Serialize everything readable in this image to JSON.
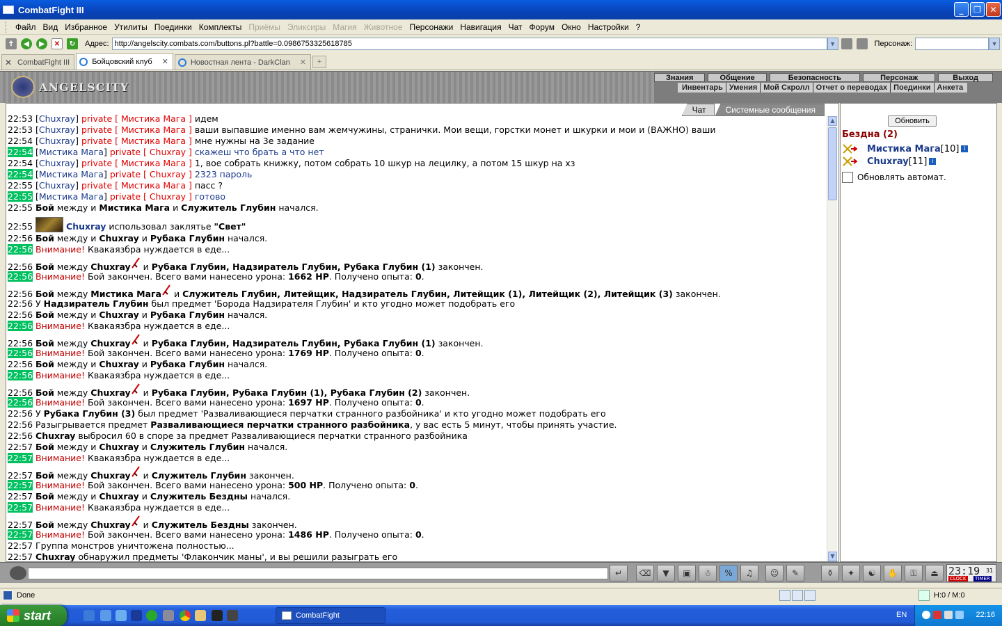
{
  "window": {
    "title": "CombatFight III"
  },
  "menu": [
    "Файл",
    "Вид",
    "Избранное",
    "Утилиты",
    "Поединки",
    "Комплекты",
    "Приёмы",
    "Эликсиры",
    "Магия",
    "Животное",
    "Персонажи",
    "Навигация",
    "Чат",
    "Форум",
    "Окно",
    "Настройки",
    "?"
  ],
  "menu_disabled": [
    "Приёмы",
    "Эликсиры",
    "Магия",
    "Животное"
  ],
  "address": {
    "label": "Адрес:",
    "url": "http://angelscity.combats.com/buttons.pl?battle=0.0986753325618785",
    "char_label": "Персонаж:"
  },
  "tabs": [
    {
      "label": "CombatFight III"
    },
    {
      "label": "Бойцовский клуб"
    },
    {
      "label": "Новостная лента - DarkClan"
    }
  ],
  "game": {
    "brand": "ANGELSCITY",
    "nav_top": [
      "Знания",
      "Общение",
      "Безопасность",
      "Персонаж",
      "Выход"
    ],
    "nav_bottom": [
      "Инвентарь",
      "Умения",
      "Мой Скролл",
      "Отчет о переводах",
      "Поединки",
      "Анкета"
    ]
  },
  "chat_tabs": {
    "chat": "Чат",
    "system": "Системные сообщения"
  },
  "chat": [
    {
      "t": "22:53",
      "hl": false,
      "parts": [
        [
          "n",
          "["
        ],
        [
          "nick",
          "Chuxray"
        ],
        [
          "n",
          "] "
        ],
        [
          "priv",
          "private [ Мистика Мага ]"
        ],
        [
          "n",
          " идем"
        ]
      ]
    },
    {
      "t": "22:53",
      "hl": false,
      "parts": [
        [
          "n",
          "["
        ],
        [
          "nick",
          "Chuxray"
        ],
        [
          "n",
          "] "
        ],
        [
          "priv",
          "private [ Мистика Мага ]"
        ],
        [
          "n",
          " ваши выпавшие именно вам жемчужины, странички. Мои вещи, горстки монет и шкурки и мои и (ВАЖНО) ваши"
        ]
      ]
    },
    {
      "t": "22:54",
      "hl": false,
      "parts": [
        [
          "n",
          "["
        ],
        [
          "nick",
          "Chuxray"
        ],
        [
          "n",
          "] "
        ],
        [
          "priv",
          "private [ Мистика Мага ]"
        ],
        [
          "n",
          " мне нужны на 3е задание"
        ]
      ]
    },
    {
      "t": "22:54",
      "hl": true,
      "parts": [
        [
          "n",
          "["
        ],
        [
          "nick",
          "Мистика Мага"
        ],
        [
          "n",
          "] "
        ],
        [
          "priv",
          "private [ Chuxray ]"
        ],
        [
          "me",
          " скажеш что брать а что нет"
        ]
      ]
    },
    {
      "t": "22:54",
      "hl": false,
      "parts": [
        [
          "n",
          "["
        ],
        [
          "nick",
          "Chuxray"
        ],
        [
          "n",
          "] "
        ],
        [
          "priv",
          "private [ Мистика Мага ]"
        ],
        [
          "n",
          " 1, вое собрать книжку, потом собрать 10 шкур на лецилку, а потом 15 шкур на хз"
        ]
      ]
    },
    {
      "t": "22:54",
      "hl": true,
      "parts": [
        [
          "n",
          "["
        ],
        [
          "nick",
          "Мистика Мага"
        ],
        [
          "n",
          "] "
        ],
        [
          "priv",
          "private [ Chuxray ]"
        ],
        [
          "me",
          " 2323 пароль"
        ]
      ]
    },
    {
      "t": "22:55",
      "hl": false,
      "parts": [
        [
          "n",
          "["
        ],
        [
          "nick",
          "Chuxray"
        ],
        [
          "n",
          "] "
        ],
        [
          "priv",
          "private [ Мистика Мага ]"
        ],
        [
          "n",
          " пасс ?"
        ]
      ]
    },
    {
      "t": "22:55",
      "hl": true,
      "parts": [
        [
          "n",
          "["
        ],
        [
          "nick",
          "Мистика Мага"
        ],
        [
          "n",
          "] "
        ],
        [
          "priv",
          "private [ Chuxray ]"
        ],
        [
          "me",
          " готово"
        ]
      ]
    },
    {
      "t": "22:55",
      "hl": false,
      "parts": [
        [
          "b",
          "Бой"
        ],
        [
          "n",
          " между и "
        ],
        [
          "b",
          "Мистика Мага"
        ],
        [
          "n",
          " и "
        ],
        [
          "b",
          "Служитель Глубин"
        ],
        [
          "n",
          " начался."
        ]
      ]
    },
    {
      "t": "22:55",
      "hl": false,
      "kind": "spell",
      "parts": [
        [
          "spell",
          ""
        ],
        [
          "nickb",
          "Chuxray"
        ],
        [
          "n",
          " использовал заклятье "
        ],
        [
          "b",
          "\"Свет\""
        ]
      ]
    },
    {
      "t": "22:56",
      "hl": false,
      "parts": [
        [
          "b",
          "Бой"
        ],
        [
          "n",
          " между и "
        ],
        [
          "b",
          "Chuxray"
        ],
        [
          "n",
          " и "
        ],
        [
          "b",
          "Рубака Глубин"
        ],
        [
          "n",
          " начался."
        ]
      ]
    },
    {
      "t": "22:56",
      "hl": true,
      "parts": [
        [
          "warn",
          "Внимание!"
        ],
        [
          "n",
          " Квакаязбра нуждается в еде..."
        ]
      ]
    },
    {
      "t": "22:56",
      "hl": false,
      "kind": "sword",
      "parts": [
        [
          "b",
          "Бой"
        ],
        [
          "n",
          " между "
        ],
        [
          "b",
          "Chuxray"
        ],
        [
          "sword",
          ""
        ],
        [
          "n",
          " и "
        ],
        [
          "b",
          "Рубака Глубин, Надзиратель Глубин, Рубака Глубин (1)"
        ],
        [
          "n",
          " закончен."
        ]
      ]
    },
    {
      "t": "22:56",
      "hl": true,
      "parts": [
        [
          "warn",
          "Внимание!"
        ],
        [
          "n",
          " Бой закончен. Всего вами нанесено урона: "
        ],
        [
          "b",
          "1662 HP"
        ],
        [
          "n",
          ". Получено опыта: "
        ],
        [
          "b",
          "0"
        ],
        [
          "n",
          "."
        ]
      ]
    },
    {
      "t": "22:56",
      "hl": false,
      "kind": "sword",
      "parts": [
        [
          "b",
          "Бой"
        ],
        [
          "n",
          " между "
        ],
        [
          "b",
          "Мистика Мага"
        ],
        [
          "sword",
          ""
        ],
        [
          "n",
          " и "
        ],
        [
          "b",
          "Служитель Глубин, Литейщик, Надзиратель Глубин, Литейщик (1), Литейщик (2), Литейщик (3)"
        ],
        [
          "n",
          " закончен."
        ]
      ]
    },
    {
      "t": "22:56",
      "hl": false,
      "parts": [
        [
          "n",
          "У "
        ],
        [
          "b",
          "Надзиратель Глубин"
        ],
        [
          "n",
          " был предмет 'Борода Надзирателя Глубин' и кто угодно может подобрать его"
        ]
      ]
    },
    {
      "t": "22:56",
      "hl": false,
      "parts": [
        [
          "b",
          "Бой"
        ],
        [
          "n",
          " между и "
        ],
        [
          "b",
          "Chuxray"
        ],
        [
          "n",
          " и "
        ],
        [
          "b",
          "Рубака Глубин"
        ],
        [
          "n",
          " начался."
        ]
      ]
    },
    {
      "t": "22:56",
      "hl": true,
      "parts": [
        [
          "warn",
          "Внимание!"
        ],
        [
          "n",
          " Квакаязбра нуждается в еде..."
        ]
      ]
    },
    {
      "t": "22:56",
      "hl": false,
      "kind": "sword",
      "parts": [
        [
          "b",
          "Бой"
        ],
        [
          "n",
          " между "
        ],
        [
          "b",
          "Chuxray"
        ],
        [
          "sword",
          ""
        ],
        [
          "n",
          " и "
        ],
        [
          "b",
          "Рубака Глубин, Надзиратель Глубин, Рубака Глубин (1)"
        ],
        [
          "n",
          " закончен."
        ]
      ]
    },
    {
      "t": "22:56",
      "hl": true,
      "parts": [
        [
          "warn",
          "Внимание!"
        ],
        [
          "n",
          " Бой закончен. Всего вами нанесено урона: "
        ],
        [
          "b",
          "1769 HP"
        ],
        [
          "n",
          ". Получено опыта: "
        ],
        [
          "b",
          "0"
        ],
        [
          "n",
          "."
        ]
      ]
    },
    {
      "t": "22:56",
      "hl": false,
      "parts": [
        [
          "b",
          "Бой"
        ],
        [
          "n",
          " между и "
        ],
        [
          "b",
          "Chuxray"
        ],
        [
          "n",
          " и "
        ],
        [
          "b",
          "Рубака Глубин"
        ],
        [
          "n",
          " начался."
        ]
      ]
    },
    {
      "t": "22:56",
      "hl": true,
      "parts": [
        [
          "warn",
          "Внимание!"
        ],
        [
          "n",
          " Квакаязбра нуждается в еде..."
        ]
      ]
    },
    {
      "t": "22:56",
      "hl": false,
      "kind": "sword",
      "parts": [
        [
          "b",
          "Бой"
        ],
        [
          "n",
          " между "
        ],
        [
          "b",
          "Chuxray"
        ],
        [
          "sword",
          ""
        ],
        [
          "n",
          " и "
        ],
        [
          "b",
          "Рубака Глубин, Рубака Глубин (1), Рубака Глубин (2)"
        ],
        [
          "n",
          " закончен."
        ]
      ]
    },
    {
      "t": "22:56",
      "hl": true,
      "parts": [
        [
          "warn",
          "Внимание!"
        ],
        [
          "n",
          " Бой закончен. Всего вами нанесено урона: "
        ],
        [
          "b",
          "1697 HP"
        ],
        [
          "n",
          ". Получено опыта: "
        ],
        [
          "b",
          "0"
        ],
        [
          "n",
          "."
        ]
      ]
    },
    {
      "t": "22:56",
      "hl": false,
      "parts": [
        [
          "n",
          "У "
        ],
        [
          "b",
          "Рубака Глубин (3)"
        ],
        [
          "n",
          " был предмет 'Разваливающиеся перчатки странного разбойника' и кто угодно может подобрать его"
        ]
      ]
    },
    {
      "t": "22:56",
      "hl": false,
      "parts": [
        [
          "n",
          "Разыгрывается предмет "
        ],
        [
          "b",
          "Разваливающиеся перчатки странного разбойника"
        ],
        [
          "n",
          ", у вас есть 5 минут, чтобы принять участие."
        ]
      ]
    },
    {
      "t": "22:56",
      "hl": false,
      "parts": [
        [
          "b",
          "Chuxray"
        ],
        [
          "n",
          " выбросил 60 в споре за предмет Разваливающиеся перчатки странного разбойника"
        ]
      ]
    },
    {
      "t": "22:57",
      "hl": false,
      "parts": [
        [
          "b",
          "Бой"
        ],
        [
          "n",
          " между и "
        ],
        [
          "b",
          "Chuxray"
        ],
        [
          "n",
          " и "
        ],
        [
          "b",
          "Служитель Глубин"
        ],
        [
          "n",
          " начался."
        ]
      ]
    },
    {
      "t": "22:57",
      "hl": true,
      "parts": [
        [
          "warn",
          "Внимание!"
        ],
        [
          "n",
          " Квакаязбра нуждается в еде..."
        ]
      ]
    },
    {
      "t": "22:57",
      "hl": false,
      "kind": "sword",
      "parts": [
        [
          "b",
          "Бой"
        ],
        [
          "n",
          " между "
        ],
        [
          "b",
          "Chuxray"
        ],
        [
          "sword",
          ""
        ],
        [
          "n",
          " и "
        ],
        [
          "b",
          "Служитель Глубин"
        ],
        [
          "n",
          " закончен."
        ]
      ]
    },
    {
      "t": "22:57",
      "hl": true,
      "parts": [
        [
          "warn",
          "Внимание!"
        ],
        [
          "n",
          " Бой закончен. Всего вами нанесено урона: "
        ],
        [
          "b",
          "500 HP"
        ],
        [
          "n",
          ". Получено опыта: "
        ],
        [
          "b",
          "0"
        ],
        [
          "n",
          "."
        ]
      ]
    },
    {
      "t": "22:57",
      "hl": false,
      "parts": [
        [
          "b",
          "Бой"
        ],
        [
          "n",
          " между и "
        ],
        [
          "b",
          "Chuxray"
        ],
        [
          "n",
          " и "
        ],
        [
          "b",
          "Служитель Бездны"
        ],
        [
          "n",
          " начался."
        ]
      ]
    },
    {
      "t": "22:57",
      "hl": true,
      "parts": [
        [
          "warn",
          "Внимание!"
        ],
        [
          "n",
          " Квакаязбра нуждается в еде..."
        ]
      ]
    },
    {
      "t": "22:57",
      "hl": false,
      "kind": "sword",
      "parts": [
        [
          "b",
          "Бой"
        ],
        [
          "n",
          " между "
        ],
        [
          "b",
          "Chuxray"
        ],
        [
          "sword",
          ""
        ],
        [
          "n",
          " и "
        ],
        [
          "b",
          "Служитель Бездны"
        ],
        [
          "n",
          " закончен."
        ]
      ]
    },
    {
      "t": "22:57",
      "hl": true,
      "parts": [
        [
          "warn",
          "Внимание!"
        ],
        [
          "n",
          " Бой закончен. Всего вами нанесено урона: "
        ],
        [
          "b",
          "1486 HP"
        ],
        [
          "n",
          ". Получено опыта: "
        ],
        [
          "b",
          "0"
        ],
        [
          "n",
          "."
        ]
      ]
    },
    {
      "t": "22:57",
      "hl": false,
      "parts": [
        [
          "n",
          "Группа монстров уничтожена полностью..."
        ]
      ]
    },
    {
      "t": "22:57",
      "hl": false,
      "parts": [
        [
          "b",
          "Chuxray"
        ],
        [
          "n",
          " обнаружил предметы 'Флакончик маны', и вы решили разыграть его"
        ]
      ]
    }
  ],
  "right": {
    "refresh": "Обновить",
    "room": "Бездна (2)",
    "users": [
      {
        "name": "Мистика Мага",
        "level": "[10]"
      },
      {
        "name": "Chuxray",
        "level": "[11]"
      }
    ],
    "auto": "Обновлять автомат."
  },
  "clock": {
    "time": "23:19",
    "sec": "31",
    "clock_label": "CLOCK",
    "timer_label": "TIMER"
  },
  "status": {
    "text": "Done",
    "hm": "H:0 / M:0"
  },
  "taskbar": {
    "start": "start",
    "task": "CombatFight",
    "lang": "EN",
    "time": "22:16"
  },
  "colors": {
    "highlight_ts": "#00c060",
    "private": "#e00000",
    "nick": "#1a3a8a"
  }
}
